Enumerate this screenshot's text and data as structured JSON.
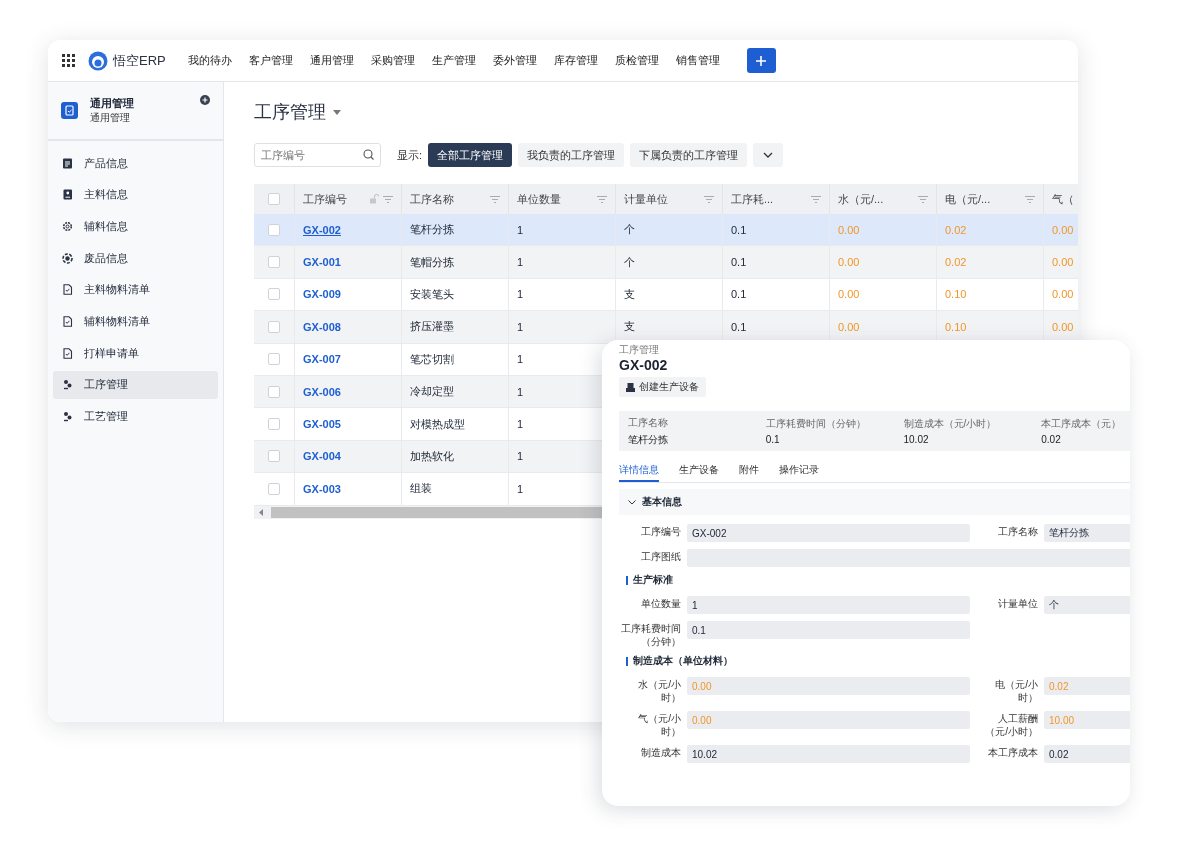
{
  "topbar": {
    "app_name": "悟空ERP",
    "nav": [
      "我的待办",
      "客户管理",
      "通用管理",
      "采购管理",
      "生产管理",
      "委外管理",
      "库存管理",
      "质检管理",
      "销售管理"
    ]
  },
  "sidebar": {
    "title": "通用管理",
    "subtitle": "通用管理",
    "items": [
      {
        "label": "产品信息",
        "selected": false
      },
      {
        "label": "主料信息",
        "selected": false
      },
      {
        "label": "辅料信息",
        "selected": false
      },
      {
        "label": "废品信息",
        "selected": false
      },
      {
        "label": "主料物料清单",
        "selected": false
      },
      {
        "label": "辅料物料清单",
        "selected": false
      },
      {
        "label": "打样申请单",
        "selected": false
      },
      {
        "label": "工序管理",
        "selected": true
      },
      {
        "label": "工艺管理",
        "selected": false
      }
    ]
  },
  "page": {
    "title": "工序管理",
    "search": {
      "placeholder": "工序编号"
    },
    "filter_label": "显示:",
    "filters": [
      {
        "label": "全部工序管理",
        "selected": true
      },
      {
        "label": "我负责的工序管理",
        "selected": false
      },
      {
        "label": "下属负责的工序管理",
        "selected": false
      }
    ]
  },
  "table": {
    "select_all": {
      "checked": false
    },
    "columns": [
      {
        "label": "工序编号",
        "kind": "link"
      },
      {
        "label": "工序名称",
        "kind": "text"
      },
      {
        "label": "单位数量",
        "kind": "text"
      },
      {
        "label": "计量单位",
        "kind": "text"
      },
      {
        "label": "工序耗...",
        "kind": "text"
      },
      {
        "label": "水（元/...",
        "kind": "cost"
      },
      {
        "label": "电（元/...",
        "kind": "cost"
      },
      {
        "label": "气（",
        "kind": "cost"
      }
    ],
    "rows": [
      {
        "selected": true,
        "checked": false,
        "cells": [
          "GX-002",
          "笔杆分拣",
          "1",
          "个",
          "0.1",
          "0.00",
          "0.02",
          "0.00"
        ]
      },
      {
        "selected": false,
        "checked": false,
        "cells": [
          "GX-001",
          "笔帽分拣",
          "1",
          "个",
          "0.1",
          "0.00",
          "0.02",
          "0.00"
        ]
      },
      {
        "selected": false,
        "checked": false,
        "cells": [
          "GX-009",
          "安装笔头",
          "1",
          "支",
          "0.1",
          "0.00",
          "0.10",
          "0.00"
        ]
      },
      {
        "selected": false,
        "checked": false,
        "cells": [
          "GX-008",
          "挤压灌墨",
          "1",
          "支",
          "0.1",
          "0.00",
          "0.10",
          "0.00"
        ]
      },
      {
        "selected": false,
        "checked": false,
        "cells": [
          "GX-007",
          "笔芯切割",
          "1"
        ]
      },
      {
        "selected": false,
        "checked": false,
        "cells": [
          "GX-006",
          "冷却定型",
          "1"
        ]
      },
      {
        "selected": false,
        "checked": false,
        "cells": [
          "GX-005",
          "对模热成型",
          "1"
        ]
      },
      {
        "selected": false,
        "checked": false,
        "cells": [
          "GX-004",
          "加热软化",
          "1"
        ]
      },
      {
        "selected": false,
        "checked": false,
        "cells": [
          "GX-003",
          "组装",
          "1"
        ]
      }
    ]
  },
  "detail": {
    "breadcrumb": "工序管理",
    "title": "GX-002",
    "action_button": "创建生产设备",
    "summary": [
      {
        "label": "工序名称",
        "value": "笔杆分拣"
      },
      {
        "label": "工序耗费时间（分钟）",
        "value": "0.1"
      },
      {
        "label": "制造成本（元/小时）",
        "value": "10.02"
      },
      {
        "label": "本工序成本（元）",
        "value": "0.02"
      }
    ],
    "tabs": [
      {
        "label": "详情信息",
        "selected": true
      },
      {
        "label": "生产设备",
        "selected": false
      },
      {
        "label": "附件",
        "selected": false
      },
      {
        "label": "操作记录",
        "selected": false
      }
    ],
    "sections": [
      {
        "title": "基本信息",
        "kind": "collapse",
        "expanded": true,
        "fields": [
          {
            "label": "工序编号",
            "value": "GX-002",
            "kind": "text"
          },
          {
            "label": "工序名称",
            "value": "笔杆分拣",
            "kind": "text"
          },
          {
            "label": "工序图纸",
            "kind": "attachment"
          }
        ]
      },
      {
        "title": "生产标准",
        "kind": "bar",
        "fields": [
          {
            "label": "单位数量",
            "value": "1",
            "kind": "text"
          },
          {
            "label": "计量单位",
            "value": "个",
            "kind": "text"
          },
          {
            "label": "工序耗费时间（分钟）",
            "value": "0.1",
            "kind": "text"
          }
        ]
      },
      {
        "title": "制造成本（单位材料）",
        "kind": "bar",
        "fields": [
          {
            "label": "水（元/小时）",
            "value": "0.00",
            "kind": "cost"
          },
          {
            "label": "电（元/小时）",
            "value": "0.02",
            "kind": "cost"
          },
          {
            "label": "气（元/小时）",
            "value": "0.00",
            "kind": "cost"
          },
          {
            "label": "人工薪酬（元/小时）",
            "value": "10.00",
            "kind": "cost"
          },
          {
            "label": "制造成本",
            "value": "10.02",
            "kind": "text"
          },
          {
            "label": "本工序成本",
            "value": "0.02",
            "kind": "text"
          }
        ]
      }
    ]
  }
}
